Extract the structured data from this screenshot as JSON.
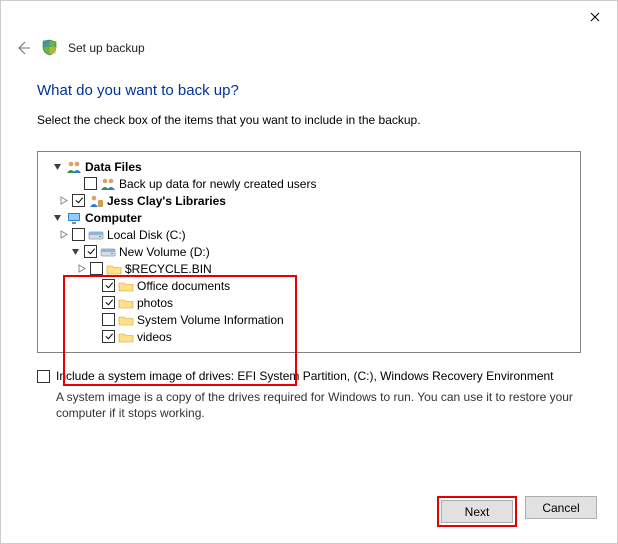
{
  "window": {
    "title": "Set up backup"
  },
  "heading": "What do you want to back up?",
  "instruction": "Select the check box of the items that you want to include in the backup.",
  "tree": {
    "dataFiles": {
      "label": "Data Files",
      "backupNewUsers": "Back up data for newly created users",
      "userLibraries": "Jess Clay's Libraries"
    },
    "computer": {
      "label": "Computer",
      "localDisk": "Local Disk (C:)",
      "newVolume": {
        "label": "New Volume (D:)",
        "recycle": "$RECYCLE.BIN",
        "officeDocs": "Office documents",
        "photos": "photos",
        "svi": "System Volume Information",
        "videos": "videos"
      }
    }
  },
  "systemImage": {
    "label": "Include a system image of drives: EFI System Partition, (C:), Windows Recovery Environment",
    "note": "A system image is a copy of the drives required for Windows to run. You can use it to restore your computer if it stops working."
  },
  "buttons": {
    "next": "Next",
    "cancel": "Cancel"
  }
}
